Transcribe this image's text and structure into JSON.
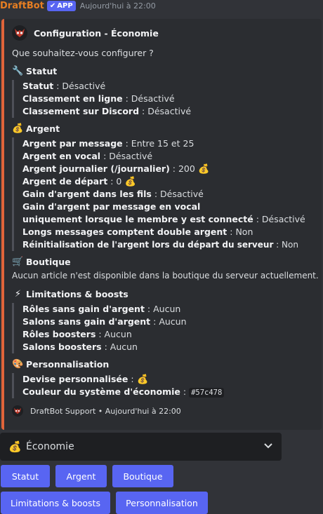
{
  "message": {
    "bot_name": "DraftBot",
    "app_badge": "APP",
    "timestamp": "Aujourd'hui à 22:00"
  },
  "embed": {
    "accent_color": "#e0643a",
    "author": "Configuration - Économie",
    "description": "Que souhaitez-vous configurer ?",
    "statut": {
      "title": "Statut",
      "lines": [
        {
          "label": "Statut",
          "value": " : Désactivé"
        },
        {
          "label": "Classement en ligne",
          "value": " : Désactivé"
        },
        {
          "label": "Classement sur Discord",
          "value": " : Désactivé"
        }
      ]
    },
    "argent": {
      "title": "Argent",
      "lines": [
        {
          "label": "Argent par message",
          "value": " : Entre 15 et 25"
        },
        {
          "label": "Argent en vocal",
          "value": " : Désactivé"
        },
        {
          "label": "Argent journalier (/journalier)",
          "value": " : 200"
        },
        {
          "label": "Argent de départ",
          "value": " : 0"
        },
        {
          "label": "Gain d'argent dans les fils",
          "value": " : Désactivé"
        },
        {
          "label": "Gain d'argent par message en vocal",
          "value": ""
        },
        {
          "label": "uniquement lorsque le membre y est connecté",
          "value": " : Désactivé"
        },
        {
          "label": "Longs messages comptent double argent",
          "value": " : Non"
        },
        {
          "label": "Réinitialisation de l'argent lors du départ du serveur",
          "value": " : Non"
        }
      ]
    },
    "boutique": {
      "title": "Boutique",
      "text": "Aucun article n'est disponible dans la boutique du serveur actuellement."
    },
    "limitations": {
      "title": "Limitations & boosts",
      "lines": [
        {
          "label": "Rôles sans gain d'argent",
          "value": " : Aucun"
        },
        {
          "label": "Salons sans gain d'argent",
          "value": " : Aucun"
        },
        {
          "label": "Rôles boosters",
          "value": " : Aucun"
        },
        {
          "label": "Salons boosters",
          "value": " : Aucun"
        }
      ]
    },
    "personnalisation": {
      "title": "Personnalisation",
      "devise_label": "Devise personnalisée",
      "devise_sep": " : ",
      "couleur_label": "Couleur du système d'économie",
      "couleur_sep": " : ",
      "couleur_value": "#57c478"
    },
    "footer": "DraftBot Support • Aujourd'hui à 22:00"
  },
  "select_menu": {
    "selected": "Économie"
  },
  "buttons": {
    "statut": "Statut",
    "argent": "Argent",
    "boutique": "Boutique",
    "limitations": "Limitations & boosts",
    "personnalisation": "Personnalisation"
  },
  "icons": {
    "statut": "wrench-icon",
    "argent": "money-bag-icon",
    "boutique": "shopping-cart-icon",
    "limitations": "lightning-icon",
    "personnalisation": "palette-icon",
    "author": "owl-avatar-icon"
  }
}
